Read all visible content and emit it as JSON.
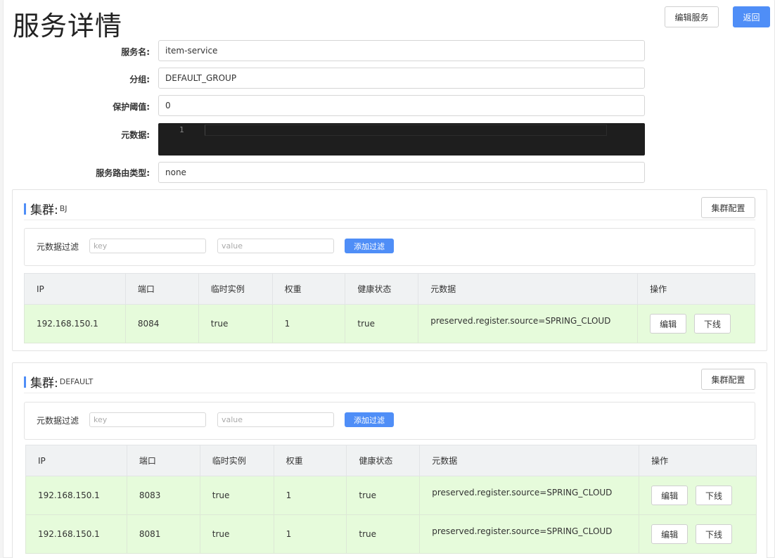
{
  "page": {
    "title": "服务详情",
    "edit_service_label": "编辑服务",
    "back_label": "返回"
  },
  "form": {
    "service_name_label": "服务名:",
    "service_name_value": "item-service",
    "group_label": "分组:",
    "group_value": "DEFAULT_GROUP",
    "threshold_label": "保护阈值:",
    "threshold_value": "0",
    "metadata_label": "元数据:",
    "metadata_line": "1",
    "route_type_label": "服务路由类型:",
    "route_type_value": "none"
  },
  "common": {
    "cluster_prefix": "集群:",
    "cluster_config_label": "集群配置",
    "filter_label": "元数据过滤",
    "key_placeholder": "key",
    "value_placeholder": "value",
    "add_filter_label": "添加过滤",
    "columns": [
      "IP",
      "端口",
      "临时实例",
      "权重",
      "健康状态",
      "元数据",
      "操作"
    ],
    "edit_label": "编辑",
    "offline_label": "下线"
  },
  "clusters": [
    {
      "name": "BJ",
      "instances": [
        {
          "ip": "192.168.150.1",
          "port": "8084",
          "ephemeral": "true",
          "weight": "1",
          "healthy": "true",
          "metadata": "preserved.register.source=SPRING_CLOUD"
        }
      ]
    },
    {
      "name": "DEFAULT",
      "instances": [
        {
          "ip": "192.168.150.1",
          "port": "8083",
          "ephemeral": "true",
          "weight": "1",
          "healthy": "true",
          "metadata": "preserved.register.source=SPRING_CLOUD"
        },
        {
          "ip": "192.168.150.1",
          "port": "8081",
          "ephemeral": "true",
          "weight": "1",
          "healthy": "true",
          "metadata": "preserved.register.source=SPRING_CLOUD"
        }
      ]
    }
  ],
  "colors": {
    "accent": "#4f8ef7",
    "healthy_row": "#e6fbdb",
    "editor_bg": "#1e1e1e"
  }
}
